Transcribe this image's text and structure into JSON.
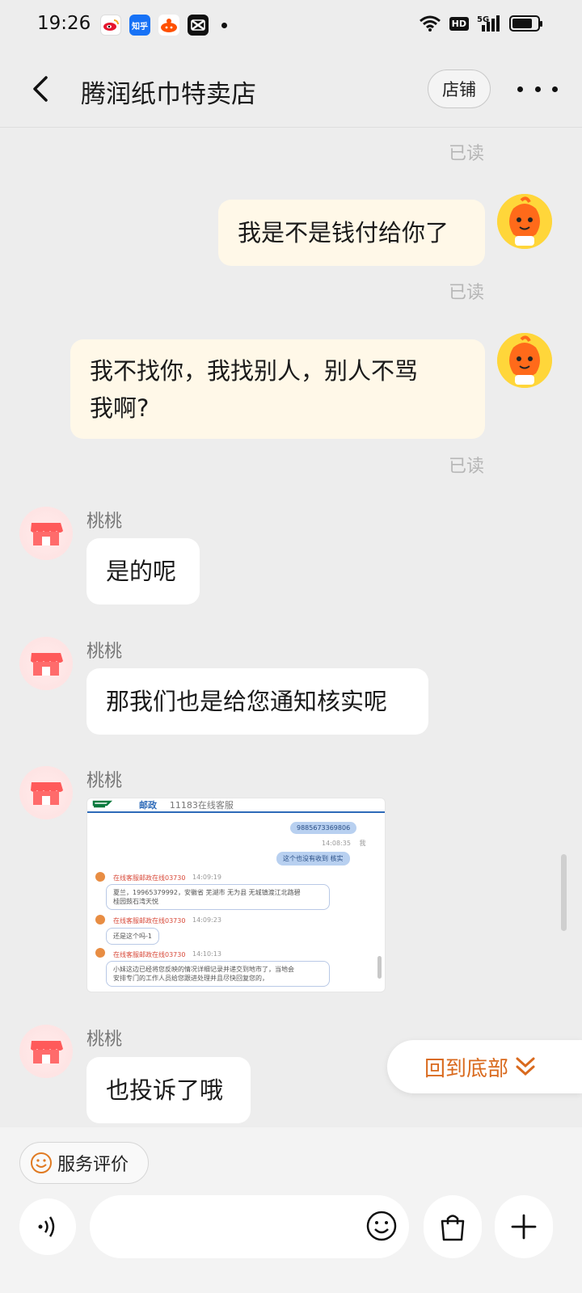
{
  "status_bar": {
    "time": "19:26",
    "apps": [
      "weibo",
      "知乎",
      "taobao",
      "capcut"
    ],
    "hd": "HD",
    "network": "5G"
  },
  "header": {
    "title": "腾润纸巾特卖店",
    "shop_button": "店铺"
  },
  "messages": {
    "read_label": "已读",
    "me_1": "我是不是钱付给你了",
    "me_2_line1": "我不找你，我找别人，别人不骂",
    "me_2_line2": "我啊?",
    "sender_name": "桃桃",
    "them_1": "是的呢",
    "them_2": "那我们也是给您通知核实呢",
    "them_3": "也投诉了哦"
  },
  "image_message": {
    "header_partial": "11183在线客服",
    "pill_1": "9885673369806",
    "pill_1_time": "14:08:35",
    "pill_1_user": "我",
    "pill_2": "这个也没有收到 核实",
    "agent": "在线客服邮政在线03730",
    "time_1": "14:09:19",
    "box_1_line1": "夏兰，19965379992，安徽省 芜湖市 无为县 无城镇渡江北路碧",
    "box_1_line2": "桂园鼓石湾天悦",
    "time_2": "14:09:23",
    "box_2": "还是这个吗-1",
    "time_3": "14:10:13",
    "box_3_line1": "小妹这边已经将您反映的情况详细记录并递交到地市了，当地会",
    "box_3_line2": "安排专门的工作人员给您跟进处理并且尽快回复您的，"
  },
  "back_to_bottom": "回到底部",
  "bottom": {
    "service_label": "服务评价",
    "input_placeholder": ""
  },
  "colors": {
    "accent": "#d96a1e",
    "bubble_me": "#fff8e8",
    "bubble_them": "#ffffff",
    "background": "#ededed"
  }
}
